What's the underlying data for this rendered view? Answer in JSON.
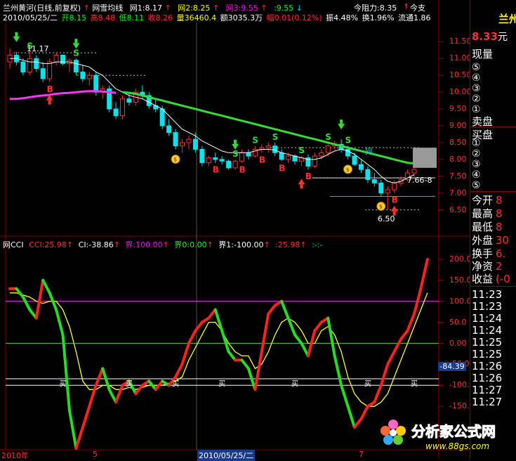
{
  "header": {
    "title": "兰州黄河(日线,前复权)",
    "indicator": "网雪均线",
    "ma_values": [
      {
        "label": "网1:8.17",
        "color": "#ffffff"
      },
      {
        "label": "网2:8.25",
        "color": "#ffff00"
      },
      {
        "label": "网3:9.55",
        "color": "#ff00ff"
      },
      {
        "label": ":9.55",
        "color": "#00ff00"
      }
    ],
    "resistance": "今阻力:8.35",
    "support": "今支",
    "date": "2010/05/25/二",
    "ohlc": [
      {
        "label": "开8.15",
        "color": "#00ff00"
      },
      {
        "label": "高8.48",
        "color": "#ff3030"
      },
      {
        "label": "低8.11",
        "color": "#00ff00"
      },
      {
        "label": "收8.26",
        "color": "#ff3030"
      },
      {
        "label": "量36460.4",
        "color": "#ffff00"
      },
      {
        "label": "额3035.3万",
        "color": "#ffffff"
      },
      {
        "label": "幅0.01(0.12%)",
        "color": "#ff3030"
      },
      {
        "label": "振4.48%",
        "color": "#ffffff"
      },
      {
        "label": "换1.96%",
        "color": "#ffffff"
      },
      {
        "label": "流通1.86",
        "color": "#ffffff"
      }
    ]
  },
  "price_axis": [
    "11.50",
    "11.00",
    "10.50",
    "10.00",
    "9.50",
    "9.00",
    "8.50",
    "8.00",
    "7.50",
    "7.00",
    "6.50"
  ],
  "price_annotations": {
    "high_label": "11.17",
    "low_label": "6.50",
    "range_label": "7.66-8",
    "net_label": "网"
  },
  "cci_header": {
    "name": "网CCI",
    "values": [
      {
        "label": "CCI:25.98",
        "color": "#ff3030"
      },
      {
        "label": "CI:-38.86",
        "color": "#ffffff"
      },
      {
        "label": "界:100.00",
        "color": "#ff00ff"
      },
      {
        "label": "界0:0.00",
        "color": "#00ff00"
      },
      {
        "label": "界1:-100.00",
        "color": "#ffffff"
      },
      {
        "label": ":25.98",
        "color": "#ff3030"
      },
      {
        "label": ":-:-",
        "color": "#00ff00"
      }
    ]
  },
  "cci_axis": [
    "200.0",
    "150.0",
    "100.0",
    "50.0",
    "0.00",
    "-50.0",
    "-100.0",
    "-150.0"
  ],
  "cci_current": "-84.39",
  "buy_label": "买",
  "date_axis": {
    "labels": [
      "2010年",
      "5",
      "2010/05/25/二",
      "7"
    ]
  },
  "side_panel": {
    "name": "兰州",
    "price": "8.33",
    "unit": "元",
    "volume_label": "现量",
    "levels_sell": [
      "⑤",
      "④",
      "③",
      "②",
      "①"
    ],
    "sell_label": "卖盘",
    "buy_label": "买盘",
    "levels_buy": [
      "①",
      "②",
      "③",
      "④",
      "⑤"
    ],
    "stats": [
      {
        "label": "今开",
        "value": "8"
      },
      {
        "label": "最高",
        "value": "8"
      },
      {
        "label": "最低",
        "value": "8"
      },
      {
        "label": "外盘",
        "value": "30"
      },
      {
        "label": "换手",
        "value": "6."
      },
      {
        "label": "净资",
        "value": "2"
      },
      {
        "label": "收益",
        "value": "(-0"
      }
    ],
    "ticks": [
      "11:23",
      "11:23",
      "11:24",
      "11:24",
      "11:25",
      "11:25",
      "11:26",
      "11:26",
      "11:27",
      "11:27"
    ]
  },
  "watermark": {
    "name": "分析家公式网",
    "url": "www.88gs.com"
  },
  "chart_data": [
    {
      "type": "candlestick",
      "title": "兰州黄河(日线,前复权)",
      "ylim": [
        6.2,
        11.8
      ],
      "candles": [
        {
          "o": 10.9,
          "h": 11.3,
          "l": 10.7,
          "c": 11.1
        },
        {
          "o": 11.1,
          "h": 11.2,
          "l": 10.8,
          "c": 10.9
        },
        {
          "o": 10.9,
          "h": 11.0,
          "l": 10.5,
          "c": 10.6
        },
        {
          "o": 10.6,
          "h": 11.2,
          "l": 10.5,
          "c": 11.0
        },
        {
          "o": 11.0,
          "h": 11.1,
          "l": 10.6,
          "c": 10.7
        },
        {
          "o": 10.7,
          "h": 10.9,
          "l": 10.3,
          "c": 10.4
        },
        {
          "o": 10.4,
          "h": 11.0,
          "l": 10.3,
          "c": 10.9
        },
        {
          "o": 10.9,
          "h": 11.17,
          "l": 10.8,
          "c": 11.1
        },
        {
          "o": 11.1,
          "h": 11.1,
          "l": 10.8,
          "c": 10.85
        },
        {
          "o": 10.85,
          "h": 11.0,
          "l": 10.6,
          "c": 10.95
        },
        {
          "o": 10.95,
          "h": 11.0,
          "l": 10.5,
          "c": 10.6
        },
        {
          "o": 10.6,
          "h": 10.8,
          "l": 10.3,
          "c": 10.4
        },
        {
          "o": 10.4,
          "h": 10.6,
          "l": 10.2,
          "c": 10.5
        },
        {
          "o": 10.5,
          "h": 10.6,
          "l": 9.9,
          "c": 10.0
        },
        {
          "o": 10.0,
          "h": 10.2,
          "l": 9.8,
          "c": 10.1
        },
        {
          "o": 10.1,
          "h": 10.2,
          "l": 9.4,
          "c": 9.5
        },
        {
          "o": 9.5,
          "h": 9.7,
          "l": 9.2,
          "c": 9.3
        },
        {
          "o": 9.3,
          "h": 9.9,
          "l": 9.2,
          "c": 9.8
        },
        {
          "o": 9.8,
          "h": 10.0,
          "l": 9.6,
          "c": 9.7
        },
        {
          "o": 9.7,
          "h": 10.1,
          "l": 9.6,
          "c": 10.0
        },
        {
          "o": 10.0,
          "h": 10.2,
          "l": 9.8,
          "c": 9.9
        },
        {
          "o": 9.9,
          "h": 10.0,
          "l": 9.5,
          "c": 9.6
        },
        {
          "o": 9.6,
          "h": 9.8,
          "l": 9.4,
          "c": 9.5
        },
        {
          "o": 9.5,
          "h": 9.6,
          "l": 8.9,
          "c": 9.0
        },
        {
          "o": 9.0,
          "h": 9.2,
          "l": 8.7,
          "c": 8.8
        },
        {
          "o": 8.8,
          "h": 8.9,
          "l": 8.3,
          "c": 8.4
        },
        {
          "o": 8.4,
          "h": 8.6,
          "l": 8.2,
          "c": 8.5
        },
        {
          "o": 8.5,
          "h": 8.7,
          "l": 8.3,
          "c": 8.6
        },
        {
          "o": 8.6,
          "h": 8.8,
          "l": 8.2,
          "c": 8.3
        },
        {
          "o": 8.3,
          "h": 8.4,
          "l": 7.8,
          "c": 7.9
        },
        {
          "o": 7.9,
          "h": 8.1,
          "l": 7.8,
          "c": 8.05
        },
        {
          "o": 8.05,
          "h": 8.2,
          "l": 7.9,
          "c": 8.0
        },
        {
          "o": 8.0,
          "h": 8.1,
          "l": 7.85,
          "c": 7.95
        },
        {
          "o": 7.95,
          "h": 8.0,
          "l": 7.7,
          "c": 7.75
        },
        {
          "o": 7.75,
          "h": 8.0,
          "l": 7.7,
          "c": 7.95
        },
        {
          "o": 7.95,
          "h": 8.3,
          "l": 7.9,
          "c": 8.2
        },
        {
          "o": 8.2,
          "h": 8.3,
          "l": 8.0,
          "c": 8.1
        },
        {
          "o": 8.1,
          "h": 8.4,
          "l": 8.05,
          "c": 8.3
        },
        {
          "o": 8.3,
          "h": 8.45,
          "l": 8.2,
          "c": 8.35
        },
        {
          "o": 8.35,
          "h": 8.5,
          "l": 8.2,
          "c": 8.4
        },
        {
          "o": 8.4,
          "h": 8.5,
          "l": 8.1,
          "c": 8.2
        },
        {
          "o": 8.2,
          "h": 8.3,
          "l": 7.95,
          "c": 8.0
        },
        {
          "o": 8.0,
          "h": 8.2,
          "l": 7.9,
          "c": 8.1
        },
        {
          "o": 8.1,
          "h": 8.15,
          "l": 7.85,
          "c": 7.95
        },
        {
          "o": 7.95,
          "h": 8.1,
          "l": 7.8,
          "c": 8.05
        },
        {
          "o": 8.05,
          "h": 8.15,
          "l": 7.7,
          "c": 7.8
        },
        {
          "o": 7.8,
          "h": 8.2,
          "l": 7.75,
          "c": 8.1
        },
        {
          "o": 8.1,
          "h": 8.3,
          "l": 8.0,
          "c": 8.2
        },
        {
          "o": 8.2,
          "h": 8.5,
          "l": 8.1,
          "c": 8.4
        },
        {
          "o": 8.4,
          "h": 8.55,
          "l": 8.3,
          "c": 8.45
        },
        {
          "o": 8.45,
          "h": 8.6,
          "l": 8.2,
          "c": 8.3
        },
        {
          "o": 8.3,
          "h": 8.4,
          "l": 8.0,
          "c": 8.1
        },
        {
          "o": 8.1,
          "h": 8.2,
          "l": 7.8,
          "c": 7.85
        },
        {
          "o": 7.85,
          "h": 8.0,
          "l": 7.6,
          "c": 7.7
        },
        {
          "o": 7.7,
          "h": 7.8,
          "l": 7.3,
          "c": 7.4
        },
        {
          "o": 7.4,
          "h": 7.6,
          "l": 7.2,
          "c": 7.3
        },
        {
          "o": 7.3,
          "h": 7.4,
          "l": 6.9,
          "c": 7.0
        },
        {
          "o": 7.0,
          "h": 7.2,
          "l": 6.5,
          "c": 7.1
        },
        {
          "o": 7.1,
          "h": 7.4,
          "l": 7.0,
          "c": 7.3
        },
        {
          "o": 7.3,
          "h": 7.5,
          "l": 7.2,
          "c": 7.4
        },
        {
          "o": 7.4,
          "h": 7.7,
          "l": 7.35,
          "c": 7.6
        },
        {
          "o": 7.6,
          "h": 7.8,
          "l": 7.5,
          "c": 7.7
        }
      ],
      "ma_white": [
        11.0,
        11.0,
        10.95,
        10.9,
        10.9,
        10.85,
        10.85,
        10.9,
        10.9,
        10.9,
        10.85,
        10.8,
        10.75,
        10.6,
        10.5,
        10.3,
        10.1,
        10.0,
        9.9,
        9.85,
        9.8,
        9.7,
        9.6,
        9.5,
        9.3,
        9.1,
        8.9,
        8.8,
        8.7,
        8.55,
        8.45,
        8.35,
        8.25,
        8.2,
        8.2,
        8.2,
        8.2,
        8.25,
        8.3,
        8.3,
        8.28,
        8.2,
        8.15,
        8.1,
        8.05,
        8.0,
        8.0,
        8.05,
        8.15,
        8.25,
        8.3,
        8.25,
        8.15,
        8.0,
        7.85,
        7.7,
        7.5,
        7.35,
        7.3,
        7.35,
        7.45,
        7.55
      ],
      "ma_green": [
        null,
        null,
        null,
        null,
        null,
        null,
        null,
        null,
        null,
        null,
        null,
        null,
        null,
        null,
        null,
        null,
        null,
        10.0,
        9.98,
        9.95,
        9.9,
        9.85,
        9.8,
        9.75,
        9.7,
        9.65,
        9.6,
        9.55,
        9.5,
        9.45,
        9.4,
        9.35,
        9.3,
        9.25,
        9.2,
        9.15,
        9.1,
        9.05,
        9.0,
        8.95,
        8.9,
        8.85,
        8.8,
        8.75,
        8.7,
        8.65,
        8.6,
        8.55,
        8.5,
        8.45,
        8.4,
        8.35,
        8.3,
        8.25,
        8.2,
        8.15,
        8.1,
        8.05,
        8.0,
        7.95,
        7.9,
        7.88
      ],
      "ma_magenta": [
        9.8,
        9.8,
        9.82,
        9.85,
        9.88,
        9.9,
        9.92,
        9.95,
        9.97,
        9.98,
        10.0,
        10.02,
        10.03,
        10.03,
        10.02,
        10.0,
        9.98
      ]
    },
    {
      "type": "line",
      "title": "网CCI",
      "ylim": [
        -250,
        240
      ],
      "series": [
        {
          "name": "CCI",
          "values": [
            130,
            130,
            110,
            80,
            60,
            150,
            120,
            80,
            20,
            -160,
            -250,
            -200,
            -150,
            -100,
            -60,
            -110,
            -140,
            -100,
            -90,
            -120,
            -100,
            -90,
            -110,
            -90,
            -100,
            -80,
            -50,
            0,
            30,
            50,
            60,
            80,
            30,
            -20,
            -40,
            -40,
            -60,
            -110,
            -20,
            70,
            90,
            100,
            60,
            20,
            0,
            -30,
            30,
            50,
            60,
            -30,
            -100,
            -150,
            -200,
            -180,
            -150,
            -140,
            -100,
            -50,
            -20,
            10,
            30,
            70,
            130,
            200
          ]
        },
        {
          "name": "CI",
          "values": [
            120,
            120,
            115,
            110,
            100,
            95,
            100,
            100,
            80,
            40,
            -20,
            -90,
            -110,
            -110,
            -100,
            -100,
            -110,
            -110,
            -105,
            -110,
            -105,
            -100,
            -100,
            -100,
            -95,
            -90,
            -80,
            -40,
            -10,
            20,
            50,
            50,
            30,
            0,
            -20,
            -30,
            -30,
            -60,
            -50,
            -20,
            20,
            50,
            60,
            50,
            30,
            0,
            0,
            30,
            40,
            20,
            -20,
            -80,
            -120,
            -140,
            -150,
            -150,
            -140,
            -120,
            -80,
            -40,
            0,
            40,
            80,
            120
          ]
        }
      ],
      "hlines": [
        100,
        0,
        -100
      ]
    }
  ]
}
